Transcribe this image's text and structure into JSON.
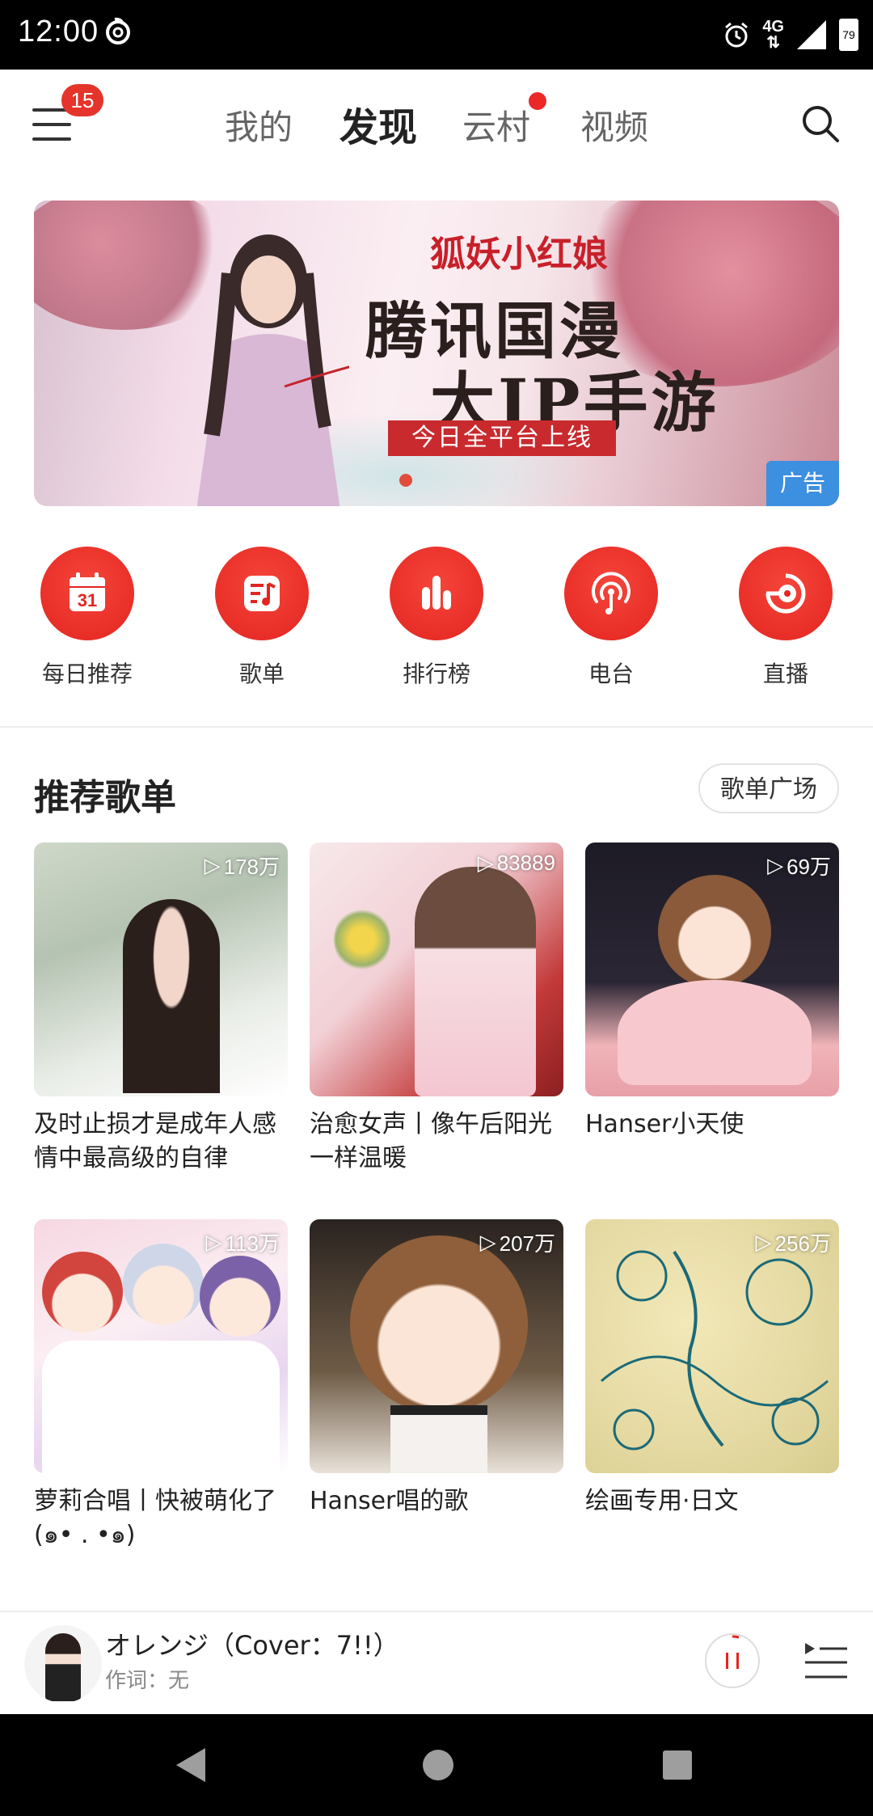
{
  "status_bar": {
    "time": "12:00",
    "network": "4G",
    "battery": "79"
  },
  "top_nav": {
    "menu_badge": "15",
    "tabs": [
      {
        "label": "我的",
        "active": false,
        "has_dot": false
      },
      {
        "label": "发现",
        "active": true,
        "has_dot": false
      },
      {
        "label": "云村",
        "active": false,
        "has_dot": true
      },
      {
        "label": "视频",
        "active": false,
        "has_dot": false
      }
    ]
  },
  "banner": {
    "logo_text": "狐妖小红娘",
    "headline_1": "腾讯国漫",
    "headline_2": "大IP手游",
    "subline": "今日全平台上线",
    "ad_label": "广告"
  },
  "quick_entries": [
    {
      "label": "每日推荐",
      "icon": "calendar-icon",
      "day": "31"
    },
    {
      "label": "歌单",
      "icon": "playlist-icon"
    },
    {
      "label": "排行榜",
      "icon": "chart-bars-icon"
    },
    {
      "label": "电台",
      "icon": "radio-icon"
    },
    {
      "label": "直播",
      "icon": "live-icon"
    }
  ],
  "recommend": {
    "title": "推荐歌单",
    "more_label": "歌单广场",
    "playlists": [
      {
        "plays": "178万",
        "title": "及时止损才是成年人感情中最高级的自律"
      },
      {
        "plays": "83889",
        "title": "治愈女声丨像午后阳光一样温暖"
      },
      {
        "plays": "69万",
        "title": "Hanser小天使"
      },
      {
        "plays": "113万",
        "title": "萝莉合唱丨快被萌化了 (๑• . •๑)"
      },
      {
        "plays": "207万",
        "title": "Hanser唱的歌"
      },
      {
        "plays": "256万",
        "title": "绘画专用·日文"
      }
    ]
  },
  "player": {
    "song": "オレンジ（Cover：7!!）",
    "sub": "作词：无"
  },
  "colors": {
    "accent": "#e32520",
    "ad_blue": "#3d8fe0"
  }
}
